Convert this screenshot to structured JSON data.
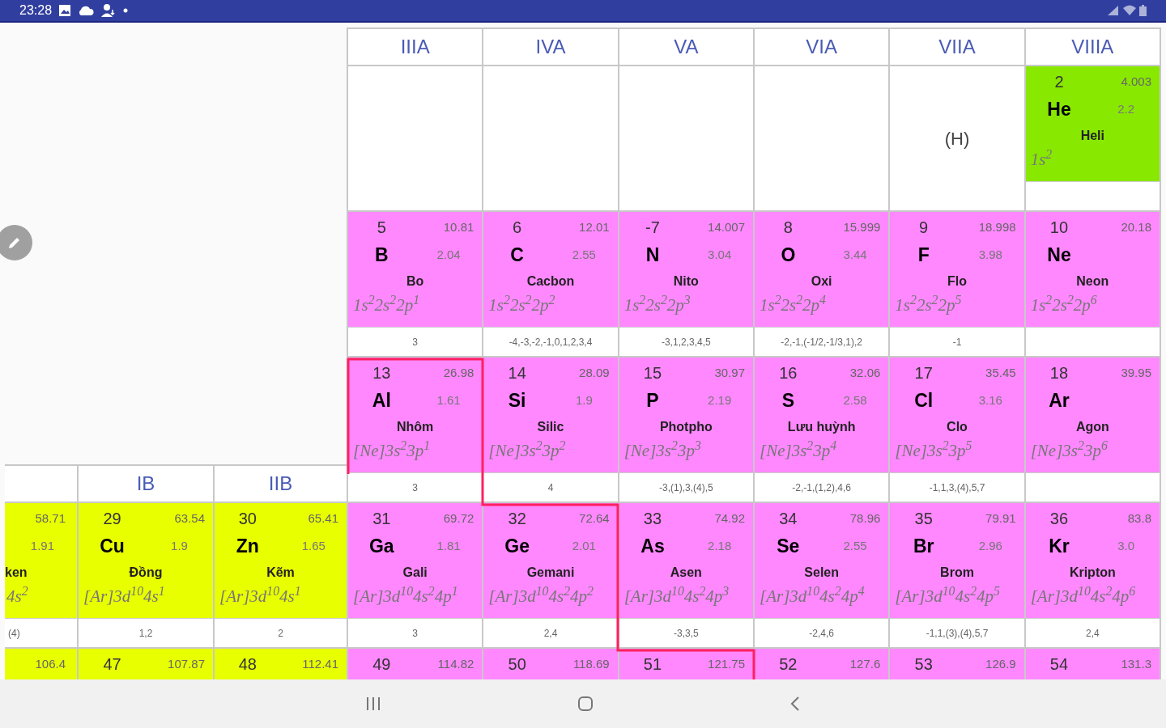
{
  "status_bar": {
    "time": "23:28"
  },
  "main_table": {
    "columns": [
      "IIIA",
      "IVA",
      "VA",
      "VIA",
      "VIIA",
      "VIIIA"
    ],
    "periods": [
      {
        "cells": [
          {
            "kind": "blank"
          },
          {
            "kind": "blank"
          },
          {
            "kind": "blank"
          },
          {
            "kind": "blank"
          },
          {
            "kind": "placeholder",
            "text": "(H)"
          },
          {
            "kind": "element",
            "number": "2",
            "mass": "4.003",
            "symbol": "He",
            "electronegativity": "2.2",
            "name": "Heli",
            "configuration": "1s$^{2}$",
            "color": "#88e800"
          }
        ]
      },
      {
        "cells": [
          {
            "kind": "element",
            "number": "5",
            "mass": "10.81",
            "symbol": "B",
            "electronegativity": "2.04",
            "name": "Bo",
            "configuration": "1s$^{2}$2s$^{2}$2p$^{1}$",
            "oxidation_states": "3",
            "color": "#ff88ff"
          },
          {
            "kind": "element",
            "number": "6",
            "mass": "12.01",
            "symbol": "C",
            "electronegativity": "2.55",
            "name": "Cacbon",
            "configuration": "1s$^{2}$2s$^{2}$2p$^{2}$",
            "oxidation_states": "-4,-3,-2,-1,0,1,2,3,4",
            "color": "#ff88ff"
          },
          {
            "kind": "element",
            "number": "-7",
            "mass": "14.007",
            "symbol": "N",
            "electronegativity": "3.04",
            "name": "Nito",
            "configuration": "1s$^{2}$2s$^{2}$2p$^{3}$",
            "oxidation_states": "-3,1,2,3,4,5",
            "color": "#ff88ff"
          },
          {
            "kind": "element",
            "number": "8",
            "mass": "15.999",
            "symbol": "O",
            "electronegativity": "3.44",
            "name": "Oxi",
            "configuration": "1s$^{2}$2s$^{2}$2p$^{4}$",
            "oxidation_states": "-2,-1,(-1/2,-1/3,1),2",
            "color": "#ff88ff"
          },
          {
            "kind": "element",
            "number": "9",
            "mass": "18.998",
            "symbol": "F",
            "electronegativity": "3.98",
            "name": "Flo",
            "configuration": "1s$^{2}$2s$^{2}$2p$^{5}$",
            "oxidation_states": "-1",
            "color": "#ff88ff"
          },
          {
            "kind": "element",
            "number": "10",
            "mass": "20.18",
            "symbol": "Ne",
            "name": "Neon",
            "configuration": "1s$^{2}$2s$^{2}$2p$^{6}$",
            "color": "#ff88ff"
          }
        ]
      },
      {
        "cells": [
          {
            "kind": "element",
            "number": "13",
            "mass": "26.98",
            "symbol": "Al",
            "electronegativity": "1.61",
            "name": "Nhôm",
            "configuration": "[Ne]3s$^{2}$3p$^{1}$",
            "oxidation_states": "3",
            "color": "#ff88ff"
          },
          {
            "kind": "element",
            "number": "14",
            "mass": "28.09",
            "symbol": "Si",
            "electronegativity": "1.9",
            "name": "Silic",
            "configuration": "[Ne]3s$^{2}$3p$^{2}$",
            "oxidation_states": "4",
            "color": "#ff88ff"
          },
          {
            "kind": "element",
            "number": "15",
            "mass": "30.97",
            "symbol": "P",
            "electronegativity": "2.19",
            "name": "Photpho",
            "configuration": "[Ne]3s$^{2}$3p$^{3}$",
            "oxidation_states": "-3,(1),3,(4),5",
            "color": "#ff88ff"
          },
          {
            "kind": "element",
            "number": "16",
            "mass": "32.06",
            "symbol": "S",
            "electronegativity": "2.58",
            "name": "Lưu huỳnh",
            "configuration": "[Ne]3s$^{2}$3p$^{4}$",
            "oxidation_states": "-2,-1,(1,2),4,6",
            "color": "#ff88ff"
          },
          {
            "kind": "element",
            "number": "17",
            "mass": "35.45",
            "symbol": "Cl",
            "electronegativity": "3.16",
            "name": "Clo",
            "configuration": "[Ne]3s$^{2}$3p$^{5}$",
            "oxidation_states": "-1,1,3,(4),5,7",
            "color": "#ff88ff"
          },
          {
            "kind": "element",
            "number": "18",
            "mass": "39.95",
            "symbol": "Ar",
            "name": "Agon",
            "configuration": "[Ne]3s$^{2}$3p$^{6}$",
            "color": "#ff88ff"
          }
        ]
      },
      {
        "cells": [
          {
            "kind": "element",
            "number": "31",
            "mass": "69.72",
            "symbol": "Ga",
            "electronegativity": "1.81",
            "name": "Gali",
            "configuration": "[Ar]3d$^{10}$4s$^{2}$4p$^{1}$",
            "oxidation_states": "3",
            "color": "#ff88ff"
          },
          {
            "kind": "element",
            "number": "32",
            "mass": "72.64",
            "symbol": "Ge",
            "electronegativity": "2.01",
            "name": "Gemani",
            "configuration": "[Ar]3d$^{10}$4s$^{2}$4p$^{2}$",
            "oxidation_states": "2,4",
            "color": "#ff88ff"
          },
          {
            "kind": "element",
            "number": "33",
            "mass": "74.92",
            "symbol": "As",
            "electronegativity": "2.18",
            "name": "Asen",
            "configuration": "[Ar]3d$^{10}$4s$^{2}$4p$^{3}$",
            "oxidation_states": "-3,3,5",
            "color": "#ff88ff"
          },
          {
            "kind": "element",
            "number": "34",
            "mass": "78.96",
            "symbol": "Se",
            "electronegativity": "2.55",
            "name": "Selen",
            "configuration": "[Ar]3d$^{10}$4s$^{2}$4p$^{4}$",
            "oxidation_states": "-2,4,6",
            "color": "#ff88ff"
          },
          {
            "kind": "element",
            "number": "35",
            "mass": "79.91",
            "symbol": "Br",
            "electronegativity": "2.96",
            "name": "Brom",
            "configuration": "[Ar]3d$^{10}$4s$^{2}$4p$^{5}$",
            "oxidation_states": "-1,1,(3),(4),5,7",
            "color": "#ff88ff"
          },
          {
            "kind": "element",
            "number": "36",
            "mass": "83.8",
            "symbol": "Kr",
            "electronegativity": "3.0",
            "name": "Kripton",
            "configuration": "[Ar]3d$^{10}$4s$^{2}$4p$^{6}$",
            "oxidation_states": "2,4",
            "color": "#ff88ff"
          }
        ]
      },
      {
        "cells": [
          {
            "kind": "element",
            "number": "49",
            "mass": "114.82",
            "color": "#ff88ff"
          },
          {
            "kind": "element",
            "number": "50",
            "mass": "118.69",
            "color": "#ff88ff"
          },
          {
            "kind": "element",
            "number": "51",
            "mass": "121.75",
            "color": "#ff88ff"
          },
          {
            "kind": "element",
            "number": "52",
            "mass": "127.6",
            "color": "#ff88ff"
          },
          {
            "kind": "element",
            "number": "53",
            "mass": "126.9",
            "color": "#ff88ff"
          },
          {
            "kind": "element",
            "number": "54",
            "mass": "131.3",
            "color": "#ff88ff"
          }
        ]
      }
    ]
  },
  "side_table": {
    "columns": [
      null,
      "IB",
      "IIB"
    ],
    "periods": [
      {
        "cells": [
          {
            "kind": "element_cut",
            "mass": "58.71",
            "electronegativity": "1.91",
            "name": "ken",
            "configuration": "4s$^{2}$",
            "oxidation_states": "(4)",
            "color": "#e8ff00"
          },
          {
            "kind": "element",
            "number": "29",
            "mass": "63.54",
            "symbol": "Cu",
            "electronegativity": "1.9",
            "name": "Đồng",
            "configuration": "[Ar]3d$^{10}$4s$^{1}$",
            "oxidation_states": "1,2",
            "color": "#e8ff00"
          },
          {
            "kind": "element",
            "number": "30",
            "mass": "65.41",
            "symbol": "Zn",
            "electronegativity": "1.65",
            "name": "Kẽm",
            "configuration": "[Ar]3d$^{10}$4s$^{1}$",
            "oxidation_states": "2",
            "color": "#e8ff00"
          }
        ]
      },
      {
        "cells": [
          {
            "kind": "element_cut",
            "mass": "106.4",
            "color": "#e8ff00"
          },
          {
            "kind": "element",
            "number": "47",
            "mass": "107.87",
            "color": "#e8ff00"
          },
          {
            "kind": "element",
            "number": "48",
            "mass": "112.41",
            "color": "#e8ff00"
          }
        ]
      }
    ]
  }
}
